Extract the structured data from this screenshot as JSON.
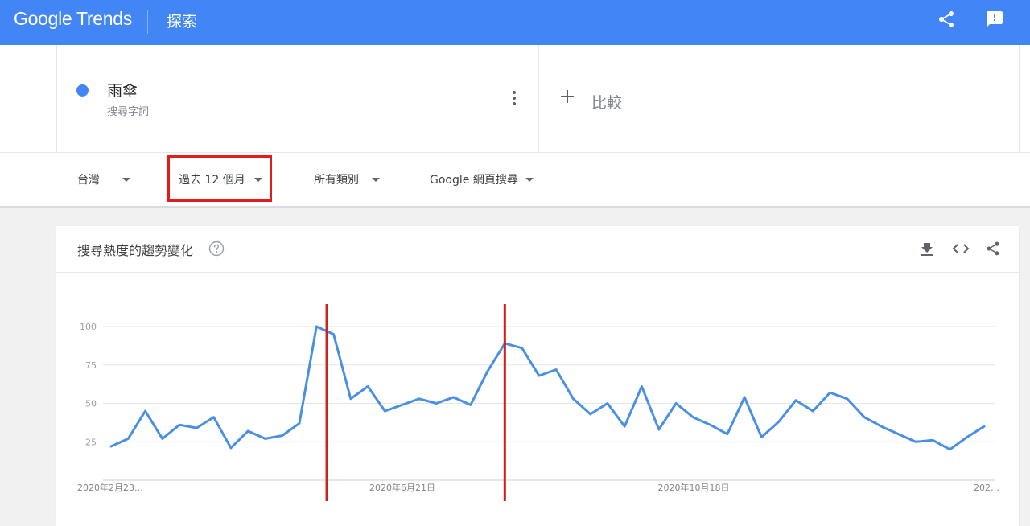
{
  "header": {
    "logo": "Google Trends",
    "page_title": "探索",
    "bg_color": "#4285f4",
    "icons": [
      "share-icon",
      "feedback-icon"
    ]
  },
  "term": {
    "name": "雨傘",
    "type": "搜尋字詞",
    "color": "#4285f4",
    "menu_icon": "more-vert-icon"
  },
  "compare": {
    "label": "比較",
    "icon": "plus-icon"
  },
  "filters": {
    "region": "台灣",
    "time": "過去 12 個月",
    "category": "所有類別",
    "property": "Google 網頁搜尋"
  },
  "highlight": {
    "target": "time-filter",
    "color": "#e41b1b"
  },
  "card": {
    "title": "搜尋熱度的趨勢變化",
    "icons": [
      "help-icon",
      "download-icon",
      "embed-icon",
      "share-icon"
    ]
  },
  "chart_data": {
    "type": "line",
    "series": [
      {
        "color": "#4a90e2",
        "values": [
          22,
          27,
          45,
          27,
          36,
          34,
          41,
          21,
          32,
          27,
          29,
          37,
          100,
          95,
          53,
          61,
          45,
          49,
          53,
          50,
          54,
          49,
          71,
          89,
          86,
          68,
          72,
          53,
          43,
          50,
          35,
          61,
          33,
          50,
          41,
          36,
          30,
          54,
          28,
          38,
          52,
          45,
          57,
          53,
          41,
          35,
          30,
          25,
          26,
          20,
          28,
          35
        ]
      }
    ],
    "x_tick_labels": [
      "2020年2月23…",
      "2020年6月21日",
      "2020年10月18日",
      "202…"
    ],
    "y_ticks": [
      25,
      50,
      75,
      100
    ],
    "ylim": [
      0,
      100
    ],
    "grid": true,
    "annotation_lines": {
      "color": "#d0201c",
      "at_point_index": [
        12.6,
        23.0
      ]
    }
  }
}
